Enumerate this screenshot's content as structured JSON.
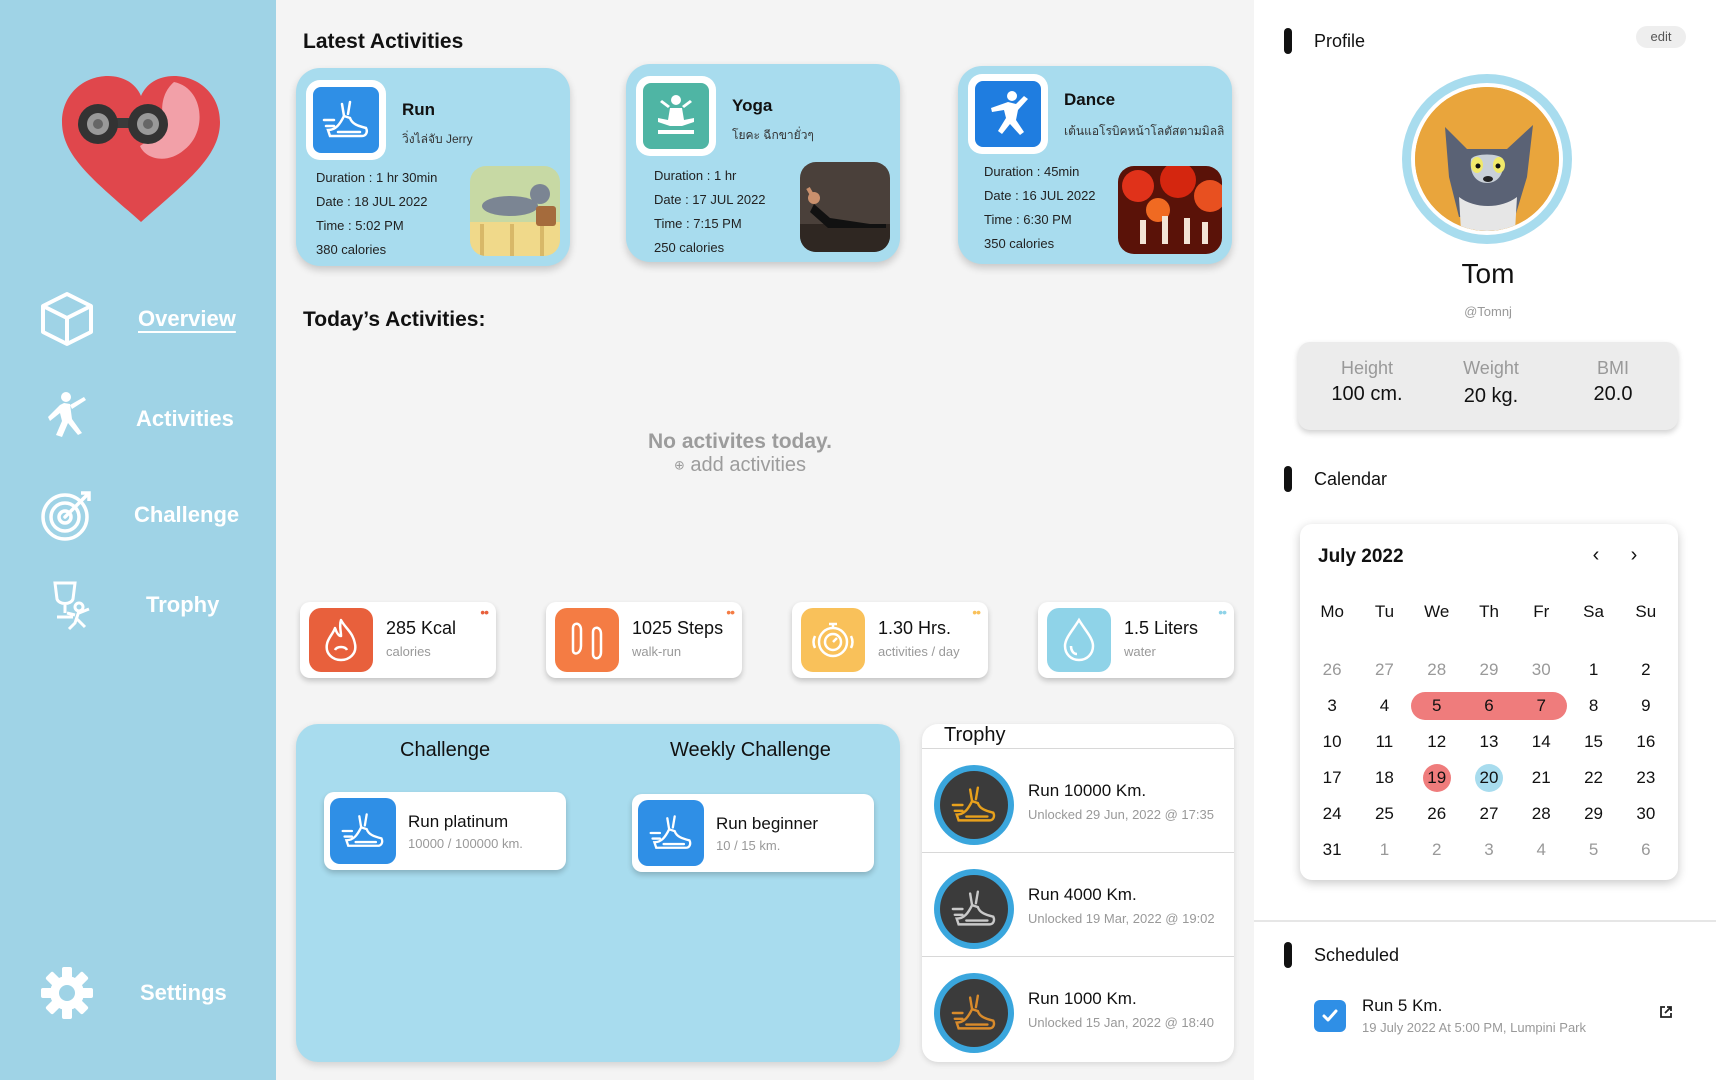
{
  "colors": {
    "sidebar": "#9fd3e6",
    "card": "#a8dcee",
    "accent_blue": "#2f8fe6",
    "highlight_red": "#ef7c7c"
  },
  "sidebar": {
    "items": [
      {
        "label": "Overview",
        "icon": "cube-icon",
        "active": true
      },
      {
        "label": "Activities",
        "icon": "exercise-person-icon"
      },
      {
        "label": "Challenge",
        "icon": "target-icon"
      },
      {
        "label": "Trophy",
        "icon": "trophy-runner-icon"
      }
    ],
    "settings": {
      "label": "Settings",
      "icon": "gear-icon"
    }
  },
  "latest": {
    "title": "Latest Activities",
    "cards": [
      {
        "name": "Run",
        "subtitle": "วิ่งไล่จับ Jerry",
        "duration": "Duration : 1 hr 30min",
        "date": "Date : 18 JUL 2022",
        "time": "Time : 5:02 PM",
        "calories": "380 calories",
        "icon": "running-shoe-icon"
      },
      {
        "name": "Yoga",
        "subtitle": "โยคะ ฉีกขายั่วๆ",
        "duration": "Duration : 1 hr",
        "date": "Date : 17 JUL 2022",
        "time": "Time : 7:15 PM",
        "calories": "250 calories",
        "icon": "yoga-icon"
      },
      {
        "name": "Dance",
        "subtitle": "เต้นแอโรบิคหน้าโลตัสตามมิลลิ",
        "duration": "Duration : 45min",
        "date": "Date : 16 JUL 2022",
        "time": "Time : 6:30 PM",
        "calories": "350 calories",
        "icon": "dance-icon"
      }
    ]
  },
  "today": {
    "title": "Today’s Activities:",
    "empty_title": "No activites today.",
    "add_label": "add activities"
  },
  "stats": [
    {
      "value": "285 Kcal",
      "label": "calories",
      "icon": "flame-icon",
      "color": "#e8603c"
    },
    {
      "value": "1025 Steps",
      "label": "walk-run",
      "icon": "footprints-icon",
      "color": "#f47c44"
    },
    {
      "value": "1.30 Hrs.",
      "label": "activities / day",
      "icon": "stopwatch-icon",
      "color": "#f9c15a"
    },
    {
      "value": "1.5 Liters",
      "label": "water",
      "icon": "water-drop-icon",
      "color": "#8fd3e8"
    }
  ],
  "challenge": {
    "heading": "Challenge",
    "weekly_heading": "Weekly Challenge",
    "main": {
      "name": "Run platinum",
      "progress": "10000 / 100000 km."
    },
    "weekly": {
      "name": "Run beginner",
      "progress": "10 / 15 km."
    }
  },
  "trophy": {
    "title": "Trophy",
    "items": [
      {
        "name": "Run 10000 Km.",
        "unlocked": "Unlocked 29 Jun, 2022 @ 17:35",
        "color": "#e8a11c"
      },
      {
        "name": "Run 4000 Km.",
        "unlocked": "Unlocked 19 Mar, 2022 @ 19:02",
        "color": "#c9c9c9"
      },
      {
        "name": "Run 1000 Km.",
        "unlocked": "Unlocked 15 Jan, 2022 @ 18:40",
        "color": "#d98b2b"
      }
    ]
  },
  "profile": {
    "heading": "Profile",
    "edit_label": "edit",
    "name": "Tom",
    "handle": "@Tomnj",
    "height_label": "Height",
    "height_value": "100 cm.",
    "weight_label": "Weight",
    "weight_value": "20 kg.",
    "bmi_label": "BMI",
    "bmi_value": "20.0"
  },
  "calendar": {
    "heading": "Calendar",
    "month": "July 2022",
    "weekdays": [
      "Mo",
      "Tu",
      "We",
      "Th",
      "Fr",
      "Sa",
      "Su"
    ],
    "weeks": [
      [
        "26",
        "27",
        "28",
        "29",
        "30",
        "1",
        "2"
      ],
      [
        "3",
        "4",
        "5",
        "6",
        "7",
        "8",
        "9"
      ],
      [
        "10",
        "11",
        "12",
        "13",
        "14",
        "15",
        "16"
      ],
      [
        "17",
        "18",
        "19",
        "20",
        "21",
        "22",
        "23"
      ],
      [
        "24",
        "25",
        "26",
        "27",
        "28",
        "29",
        "30"
      ],
      [
        "31",
        "1",
        "2",
        "3",
        "4",
        "5",
        "6"
      ]
    ]
  },
  "scheduled": {
    "heading": "Scheduled",
    "items": [
      {
        "title": "Run 5 Km.",
        "detail": "19 July 2022 At 5:00 PM, Lumpini Park",
        "checked": true
      }
    ]
  }
}
